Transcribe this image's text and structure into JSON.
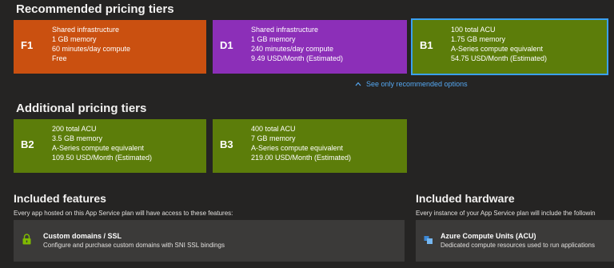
{
  "recommended": {
    "title": "Recommended pricing tiers",
    "tiers": [
      {
        "code": "F1",
        "lines": [
          "Shared infrastructure",
          "1 GB memory",
          "60 minutes/day compute",
          "Free"
        ],
        "color": "#ca5010"
      },
      {
        "code": "D1",
        "lines": [
          "Shared infrastructure",
          "1 GB memory",
          "240 minutes/day compute",
          "9.49 USD/Month (Estimated)"
        ],
        "color": "#8c2fb8"
      },
      {
        "code": "B1",
        "lines": [
          "100 total ACU",
          "1.75 GB memory",
          "A-Series compute equivalent",
          "54.75 USD/Month (Estimated)"
        ],
        "color": "#5c7d0a",
        "selected": true
      }
    ],
    "link_text": "See only recommended options"
  },
  "additional": {
    "title": "Additional pricing tiers",
    "tiers": [
      {
        "code": "B2",
        "lines": [
          "200 total ACU",
          "3.5 GB memory",
          "A-Series compute equivalent",
          "109.50 USD/Month (Estimated)"
        ],
        "color": "#5c7d0a"
      },
      {
        "code": "B3",
        "lines": [
          "400 total ACU",
          "7 GB memory",
          "A-Series compute equivalent",
          "219.00 USD/Month (Estimated)"
        ],
        "color": "#5c7d0a"
      }
    ]
  },
  "features": {
    "title": "Included features",
    "description": "Every app hosted on this App Service plan will have access to these features:",
    "items": [
      {
        "title": "Custom domains / SSL",
        "description": "Configure and purchase custom domains with SNI SSL bindings",
        "icon": "lock-icon"
      }
    ]
  },
  "hardware": {
    "title": "Included hardware",
    "description": "Every instance of your App Service plan will include the followin",
    "items": [
      {
        "title": "Azure Compute Units (ACU)",
        "description": "Dedicated compute resources used to run applications",
        "icon": "acu-icon"
      }
    ]
  },
  "colors": {
    "selected_border": "#3aa0f3",
    "link": "#55a8f2",
    "panel": "#3b3a39",
    "background": "#252423"
  }
}
